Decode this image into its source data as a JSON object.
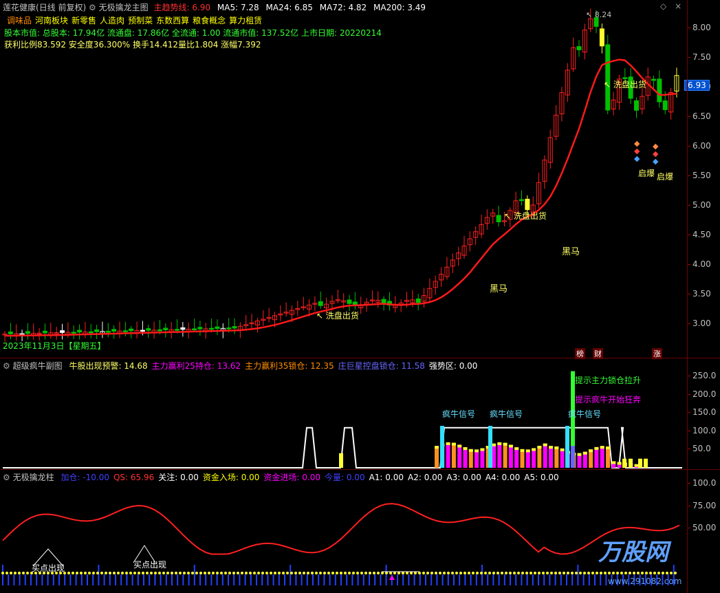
{
  "main": {
    "stock_name": "莲花健康",
    "period": "(日线 前复权)",
    "indicator_name": "无极擒龙主图",
    "trend_line": {
      "label": "主趋势线:",
      "value": "6.90"
    },
    "ma5": "MA5: 7.28",
    "ma24": "MA24: 6.85",
    "ma72": "MA72: 4.82",
    "ma200": "MA200: 3.49",
    "concepts": [
      "调味品",
      "河南板块",
      "新零售",
      "人造肉",
      "预制菜",
      "东数西算",
      "粮食概念",
      "算力租赁"
    ],
    "info_line": "股本市值: 总股本: 17.94亿 流通盘: 17.86亿 全流通: 1.00 流通市值: 137.52亿 上市日期: 20220214",
    "profit_line": "获利比例83.592 安全度36.300% 换手14.412量比1.804 涨幅7.392",
    "date_label": "2023年11月3日【星期五】",
    "y_ticks": [
      "8.00",
      "7.50",
      "7.00",
      "6.50",
      "6.00",
      "5.50",
      "5.00",
      "4.50",
      "4.00",
      "3.50",
      "3.00"
    ],
    "price_tag": "6.93",
    "high_label": "8.24",
    "annotations": {
      "wash1": "洗盘出货",
      "wash2": "洗盘出货",
      "wash3": "洗盘出货",
      "dark1": "黑马",
      "dark2": "黑马",
      "burst1": "启爆",
      "burst2": "启爆"
    },
    "badges": [
      "榜",
      "财",
      "涨"
    ]
  },
  "sub1": {
    "name": "超级疯牛副图",
    "items": [
      {
        "text": "牛股出现预警: 14.68",
        "color": "#ffff66"
      },
      {
        "text": "主力赢利25持仓: 13.62",
        "color": "#ff00ff"
      },
      {
        "text": "主力赢利35锁仓: 12.35",
        "color": "#ff8c00"
      },
      {
        "text": "庄巨星控盘锁仓: 11.58",
        "color": "#6666ff"
      },
      {
        "text": "强势区: 0.00",
        "color": "#ffffff"
      }
    ],
    "y_ticks": [
      "250.0",
      "200.0",
      "150.0",
      "100.0",
      "50.0"
    ],
    "signals": [
      "疯牛信号",
      "疯牛信号",
      "疯牛信号"
    ],
    "tip1": "提示主力锁仓拉升",
    "tip2": "提示疯牛开始狂奔"
  },
  "sub2": {
    "name": "无极擒龙柱",
    "items": [
      {
        "text": "加仓: -10.00",
        "color": "#4040ff"
      },
      {
        "text": "QS: 65.96",
        "color": "#ff3030"
      },
      {
        "text": "关注: 0.00",
        "color": "#ffffff"
      },
      {
        "text": "资金入场: 0.00",
        "color": "#ffff00"
      },
      {
        "text": "资金进场: 0.00",
        "color": "#ff00ff"
      },
      {
        "text": "今量: 0.00",
        "color": "#4040ff"
      },
      {
        "text": "A1: 0.00",
        "color": "#ffffff"
      },
      {
        "text": "A2: 0.00",
        "color": "#ffffff"
      },
      {
        "text": "A3: 0.00",
        "color": "#ffffff"
      },
      {
        "text": "A4: 0.00",
        "color": "#ffffff"
      },
      {
        "text": "A5: 0.00",
        "color": "#ffffff"
      }
    ],
    "y_ticks": [
      "100.0",
      "75.00",
      "50.00"
    ],
    "signals": [
      "买点出现",
      "买点出现"
    ]
  },
  "watermark": {
    "logo": "万股网",
    "url": "www.291082.com"
  },
  "colors": {
    "up": "#ff2020",
    "down": "#00b000",
    "trend": "#ff1a1a",
    "border": "#8b0000"
  }
}
